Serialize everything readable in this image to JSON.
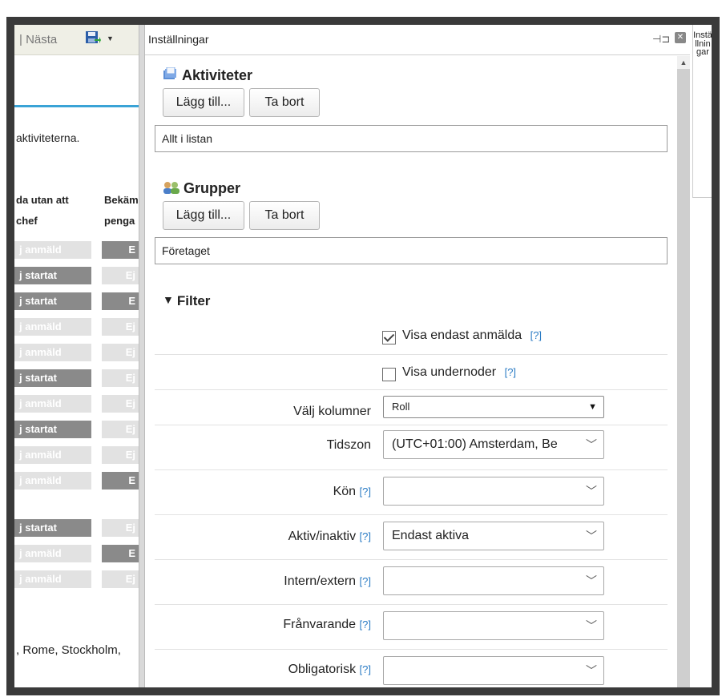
{
  "left_panel": {
    "nav_next": "| Nästa",
    "description_fragment": "aktiviteterna.",
    "col1_header_line1": "da utan att",
    "col1_header_line2": "chef",
    "col2_header_line1": "Bekäm",
    "col2_header_line2": "penga",
    "rows": [
      {
        "c1": "j anmäld",
        "c1_style": "light",
        "c2": "E",
        "c2_style": "dark"
      },
      {
        "c1": "j startat",
        "c1_style": "dark",
        "c2": "Ej",
        "c2_style": "light"
      },
      {
        "c1": "j startat",
        "c1_style": "dark",
        "c2": "E",
        "c2_style": "dark"
      },
      {
        "c1": "j anmäld",
        "c1_style": "light",
        "c2": "Ej",
        "c2_style": "light"
      },
      {
        "c1": "j anmäld",
        "c1_style": "light",
        "c2": "Ej",
        "c2_style": "light"
      },
      {
        "c1": "j startat",
        "c1_style": "dark",
        "c2": "Ej",
        "c2_style": "light"
      },
      {
        "c1": "j anmäld",
        "c1_style": "light",
        "c2": "Ej",
        "c2_style": "light"
      },
      {
        "c1": "j startat",
        "c1_style": "dark",
        "c2": "Ej",
        "c2_style": "light"
      },
      {
        "c1": "j anmäld",
        "c1_style": "light",
        "c2": "Ej",
        "c2_style": "light"
      },
      {
        "c1": "j anmäld",
        "c1_style": "light",
        "c2": "E",
        "c2_style": "dark"
      },
      {
        "c1": "j startat",
        "c1_style": "dark",
        "c2": "Ej",
        "c2_style": "light"
      },
      {
        "c1": "j anmäld",
        "c1_style": "light",
        "c2": "E",
        "c2_style": "dark"
      },
      {
        "c1": "j anmäld",
        "c1_style": "light",
        "c2": "Ej",
        "c2_style": "light"
      }
    ],
    "timezone_fragment": ", Rome, Stockholm,"
  },
  "settings": {
    "title": "Inställningar",
    "side_tab_label": "Inställningar",
    "activities": {
      "title": "Aktiviteter",
      "add_label": "Lägg till...",
      "remove_label": "Ta bort",
      "list_value": "Allt i listan"
    },
    "groups": {
      "title": "Grupper",
      "add_label": "Lägg till...",
      "remove_label": "Ta bort",
      "list_value": "Företaget"
    },
    "filter": {
      "title": "Filter",
      "help": "[?]",
      "only_registered_label": "Visa endast anmälda",
      "only_registered_checked": true,
      "show_subnodes_label": "Visa undernoder",
      "show_subnodes_checked": false,
      "columns_label": "Välj kolumner",
      "columns_value": "Roll",
      "timezone_label": "Tidszon",
      "timezone_value": "(UTC+01:00) Amsterdam, Be",
      "gender_label": "Kön",
      "gender_value": "",
      "active_label": "Aktiv/inaktiv",
      "active_value": "Endast aktiva",
      "internal_label": "Intern/extern",
      "internal_value": "",
      "absent_label": "Frånvarande",
      "absent_value": "",
      "mandatory_label": "Obligatorisk",
      "mandatory_value": ""
    }
  }
}
